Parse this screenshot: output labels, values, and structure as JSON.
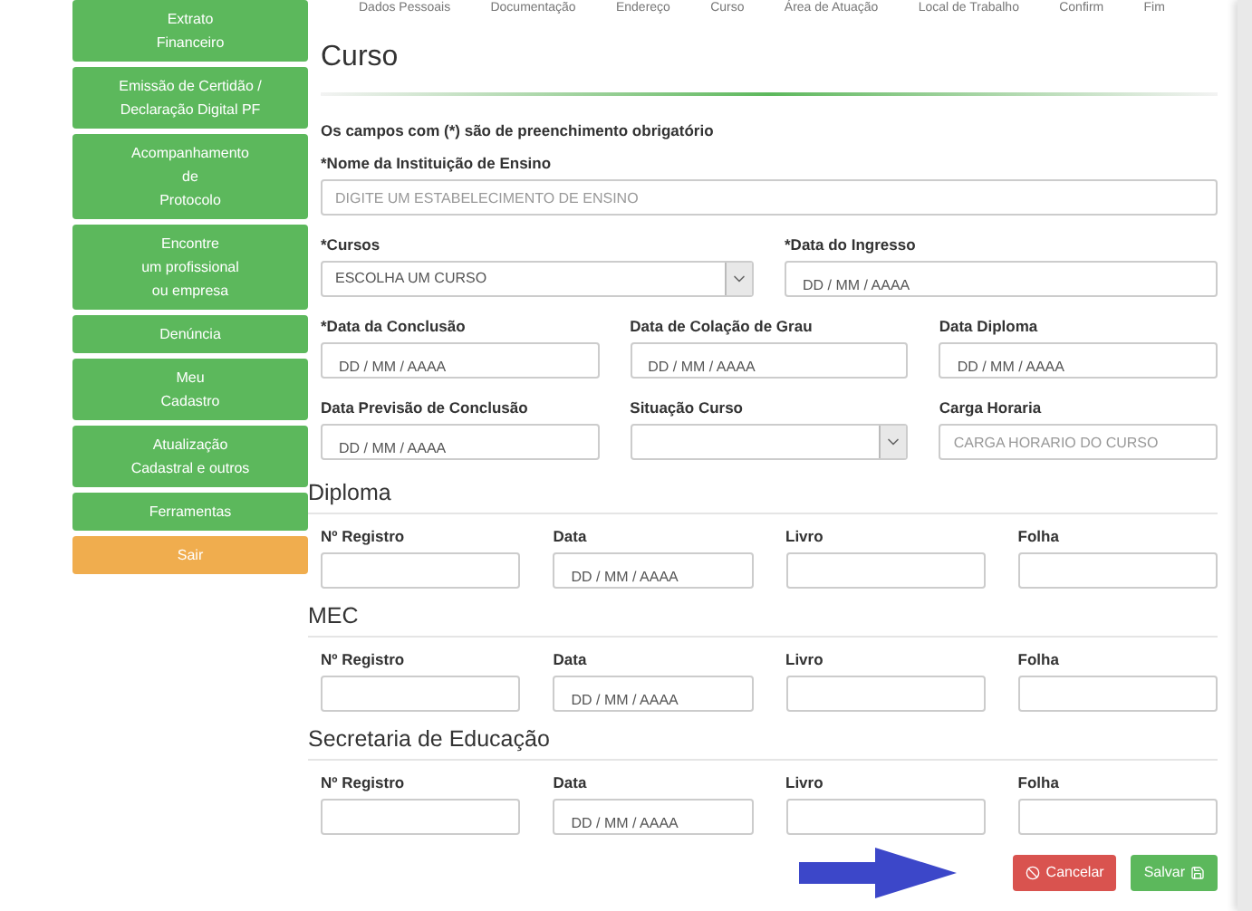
{
  "sidebar": {
    "items": [
      {
        "label": "Extrato\nFinanceiro",
        "kind": "menu"
      },
      {
        "label": "Emissão de Certidão /\nDeclaração Digital PF",
        "kind": "menu"
      },
      {
        "label": "Acompanhamento\nde\nProtocolo",
        "kind": "menu"
      },
      {
        "label": "Encontre\num profissional\nou empresa",
        "kind": "menu"
      },
      {
        "label": "Denúncia",
        "kind": "menu"
      },
      {
        "label": "Meu\nCadastro",
        "kind": "menu"
      },
      {
        "label": "Atualização\nCadastral e outros",
        "kind": "menu"
      },
      {
        "label": "Ferramentas",
        "kind": "menu"
      },
      {
        "label": "Sair",
        "kind": "exit"
      }
    ]
  },
  "steps": [
    "Dados Pessoais",
    "Documentação",
    "Endereço",
    "Curso",
    "Área de Atuação",
    "Local de Trabalho",
    "Confirm",
    "Fim"
  ],
  "form": {
    "title": "Curso",
    "note": "Os campos com (*) são de preenchimento obrigatório",
    "rows": [
      [
        {
          "label": "*Nome da Instituição de Ensino",
          "kind": "text",
          "placeholder": "DIGITE UM ESTABELECIMENTO DE ENSINO"
        }
      ],
      [
        {
          "label": "*Cursos",
          "kind": "select",
          "value": "ESCOLHA UM CURSO"
        },
        {
          "label": "*Data do Ingresso",
          "kind": "date",
          "placeholder": "DD / MM / AAAA"
        }
      ],
      [
        {
          "label": "*Data da Conclusão",
          "kind": "date",
          "placeholder": "DD / MM / AAAA"
        },
        {
          "label": "Data de Colação de Grau",
          "kind": "date",
          "placeholder": "DD / MM / AAAA"
        },
        {
          "label": "Data Diploma",
          "kind": "date",
          "placeholder": "DD / MM / AAAA"
        }
      ],
      [
        {
          "label": "Data Previsão de Conclusão",
          "kind": "date",
          "placeholder": "DD / MM / AAAA"
        },
        {
          "label": "Situação Curso",
          "kind": "select"
        },
        {
          "label": "Carga Horaria",
          "kind": "text",
          "placeholder": "CARGA HORARIO DO CURSO"
        }
      ]
    ],
    "sections": [
      {
        "title": "Diploma",
        "fields": [
          {
            "label": "Nº Registro",
            "kind": "text"
          },
          {
            "label": "Data",
            "kind": "date",
            "placeholder": "DD / MM / AAAA"
          },
          {
            "label": "Livro",
            "kind": "text"
          },
          {
            "label": "Folha",
            "kind": "text"
          }
        ]
      },
      {
        "title": "MEC",
        "fields": [
          {
            "label": "Nº Registro",
            "kind": "text"
          },
          {
            "label": "Data",
            "kind": "date",
            "placeholder": "DD / MM / AAAA"
          },
          {
            "label": "Livro",
            "kind": "text"
          },
          {
            "label": "Folha",
            "kind": "text"
          }
        ]
      },
      {
        "title": "Secretaria de Educação",
        "fields": [
          {
            "label": "Nº Registro",
            "kind": "text"
          },
          {
            "label": "Data",
            "kind": "date",
            "placeholder": "DD / MM / AAAA"
          },
          {
            "label": "Livro",
            "kind": "text"
          },
          {
            "label": "Folha",
            "kind": "text"
          }
        ]
      }
    ],
    "buttons": [
      {
        "label": "Cancelar",
        "kind": "cancel"
      },
      {
        "label": "Salvar",
        "kind": "save"
      }
    ]
  }
}
